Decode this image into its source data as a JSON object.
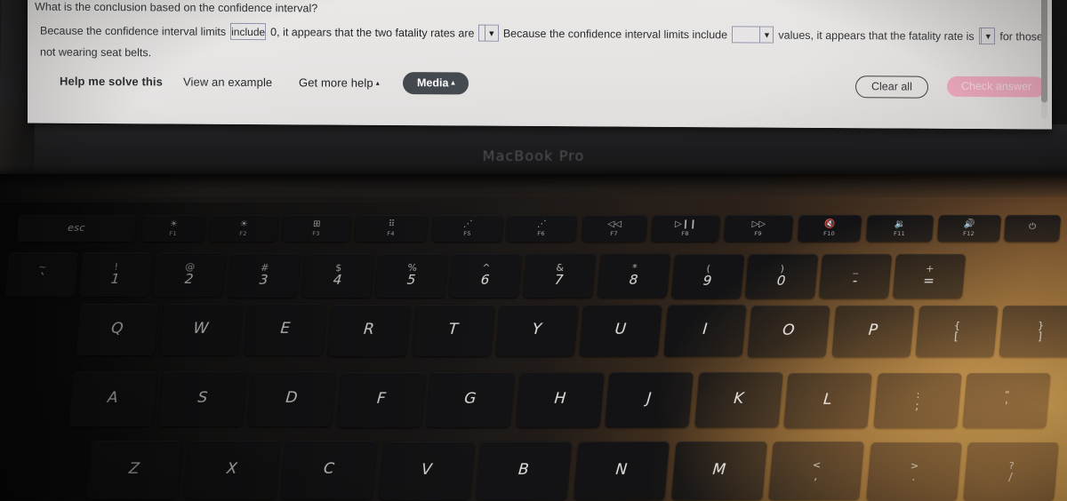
{
  "screen": {
    "question": {
      "title": "What is the conclusion based on the confidence interval?",
      "line1_part1": "Because the confidence interval limits",
      "answer1": "include",
      "line1_part2": "0, it appears that the two fatality rates are",
      "answer2": "",
      "line1_part3": "Because the confidence interval limits include",
      "answer3": "",
      "line1_part4": "values, it appears that the fatality rate is",
      "answer4": "",
      "line1_part5": "for those",
      "line2": "not wearing seat belts."
    },
    "buttons": {
      "help_me_solve": "Help me solve this",
      "view_example": "View an example",
      "get_more_help": "Get more help",
      "media": "Media",
      "clear_all": "Clear all",
      "check_answer": "Check answer",
      "caret": "▴",
      "dropdown_arrow": "▼"
    },
    "colors": {
      "media_pill": "#41464d",
      "check_answer_pill": "#f3a4bd",
      "answer_box_border": "#8e8fa8",
      "screen_bg": "#eceaea"
    }
  },
  "laptop": {
    "brand_text": "MacBook Pro"
  },
  "keyboard": {
    "function_row": [
      {
        "name": "esc",
        "label": "esc",
        "fnum": ""
      },
      {
        "name": "f1-brightness-down",
        "glyph": "☀",
        "fnum": "F1"
      },
      {
        "name": "f2-brightness-up",
        "glyph": "☀",
        "fnum": "F2"
      },
      {
        "name": "f3-mission-control",
        "glyph": "⊞",
        "fnum": "F3"
      },
      {
        "name": "f4-launchpad",
        "glyph": "⠿",
        "fnum": "F4"
      },
      {
        "name": "f5-keyboard-backlight-down",
        "glyph": "⋰",
        "fnum": "F5"
      },
      {
        "name": "f6-keyboard-backlight-up",
        "glyph": "⋰",
        "fnum": "F6"
      },
      {
        "name": "f7-rewind",
        "glyph": "◁◁",
        "fnum": "F7"
      },
      {
        "name": "f8-play-pause",
        "glyph": "▷❙❙",
        "fnum": "F8"
      },
      {
        "name": "f9-fast-forward",
        "glyph": "▷▷",
        "fnum": "F9"
      },
      {
        "name": "f10-mute",
        "glyph": "🔇",
        "fnum": "F10"
      },
      {
        "name": "f11-volume-down",
        "glyph": "🔉",
        "fnum": "F11"
      },
      {
        "name": "f12-volume-up",
        "glyph": "🔊",
        "fnum": "F12"
      },
      {
        "name": "power-touchid",
        "glyph": "⏻",
        "fnum": ""
      }
    ],
    "number_row": [
      {
        "top": "~",
        "bot": "`"
      },
      {
        "top": "!",
        "bot": "1"
      },
      {
        "top": "@",
        "bot": "2"
      },
      {
        "top": "#",
        "bot": "3"
      },
      {
        "top": "$",
        "bot": "4"
      },
      {
        "top": "%",
        "bot": "5"
      },
      {
        "top": "^",
        "bot": "6"
      },
      {
        "top": "&",
        "bot": "7"
      },
      {
        "top": "*",
        "bot": "8"
      },
      {
        "top": "(",
        "bot": "9"
      },
      {
        "top": ")",
        "bot": "0"
      },
      {
        "top": "_",
        "bot": "-"
      },
      {
        "top": "+",
        "bot": "="
      }
    ],
    "qwerty_row": [
      {
        "bot": "Q"
      },
      {
        "bot": "W"
      },
      {
        "bot": "E"
      },
      {
        "bot": "R"
      },
      {
        "bot": "T"
      },
      {
        "bot": "Y"
      },
      {
        "bot": "U"
      },
      {
        "bot": "I"
      },
      {
        "bot": "O"
      },
      {
        "bot": "P"
      },
      {
        "top": "{",
        "bot": "["
      },
      {
        "top": "}",
        "bot": "]"
      }
    ],
    "home_row": [
      {
        "bot": "A"
      },
      {
        "bot": "S"
      },
      {
        "bot": "D"
      },
      {
        "bot": "F"
      },
      {
        "bot": "G"
      },
      {
        "bot": "H"
      },
      {
        "bot": "J"
      },
      {
        "bot": "K"
      },
      {
        "bot": "L"
      },
      {
        "top": ":",
        "bot": ";"
      },
      {
        "top": "\"",
        "bot": "'"
      }
    ],
    "bottom_row": [
      {
        "bot": "Z"
      },
      {
        "bot": "X"
      },
      {
        "bot": "C"
      },
      {
        "bot": "V"
      },
      {
        "bot": "B"
      },
      {
        "bot": "N"
      },
      {
        "bot": "M"
      },
      {
        "top": "<",
        "bot": ","
      },
      {
        "top": ">",
        "bot": "."
      },
      {
        "top": "?",
        "bot": "/"
      }
    ]
  }
}
